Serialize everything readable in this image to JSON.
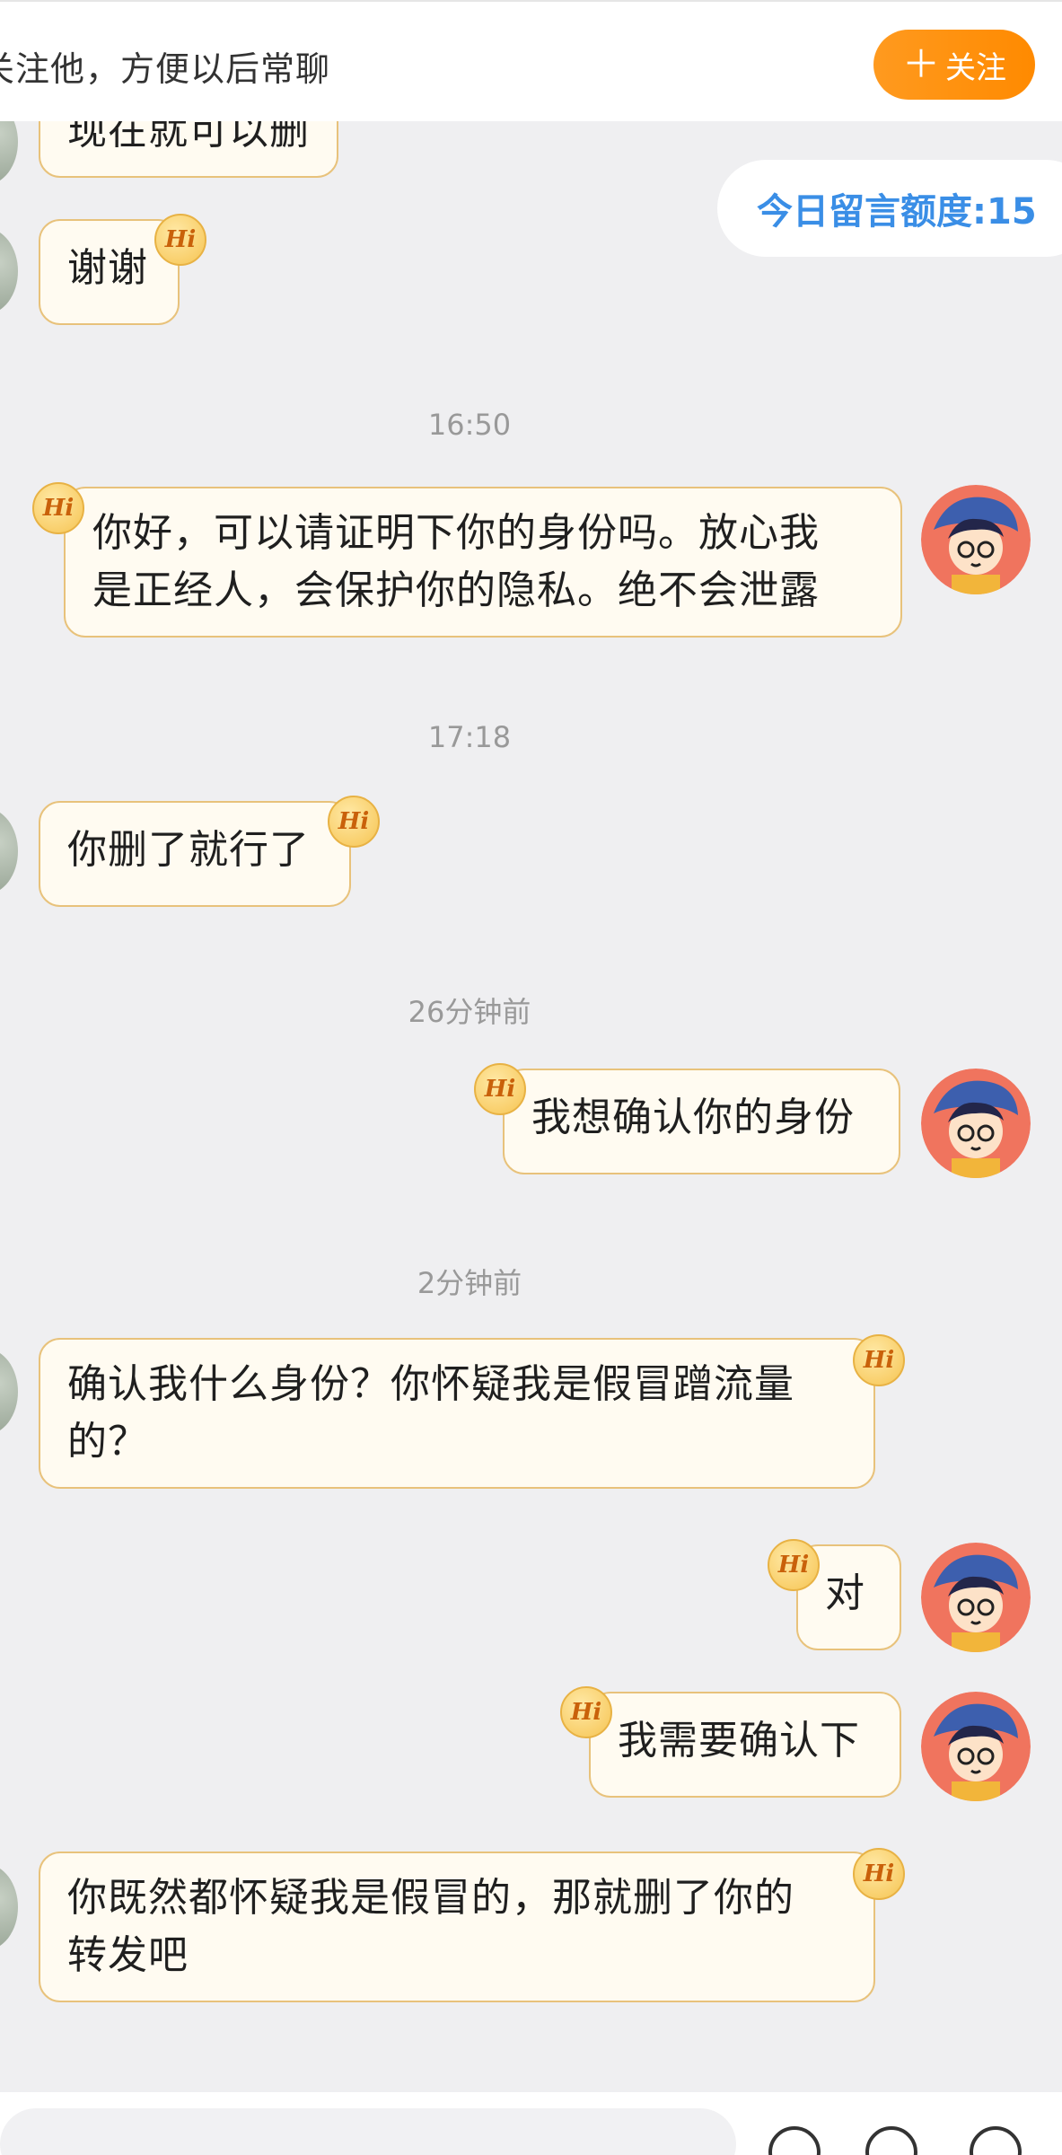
{
  "follow_bar": {
    "hint": "关注他，方便以后常聊",
    "follow_plus": "＋",
    "follow_label": "关注"
  },
  "quota": {
    "label": "今日留言额度:15"
  },
  "hi_badge": "Hi",
  "messages": [
    {
      "id": "m0",
      "side": "left",
      "text": "现在就可以删"
    },
    {
      "id": "m1",
      "side": "left",
      "text": "谢谢"
    },
    {
      "id": "t1",
      "type": "time",
      "text": "16:50"
    },
    {
      "id": "m2",
      "side": "right",
      "lines": [
        "你好，可以请证明下你的身份吗。放心我",
        "是正经人，会保护你的隐私。绝不会泄露"
      ]
    },
    {
      "id": "t2",
      "type": "time",
      "text": "17:18"
    },
    {
      "id": "m3",
      "side": "left",
      "text": "你删了就行了"
    },
    {
      "id": "t3",
      "type": "time",
      "text": "26分钟前"
    },
    {
      "id": "m4",
      "side": "right",
      "text": "我想确认你的身份"
    },
    {
      "id": "t4",
      "type": "time",
      "text": "2分钟前"
    },
    {
      "id": "m5",
      "side": "left",
      "lines": [
        "确认我什么身份？你怀疑我是假冒蹭流量",
        "的？"
      ]
    },
    {
      "id": "m6",
      "side": "right",
      "text": "对"
    },
    {
      "id": "m7",
      "side": "right",
      "text": "我需要确认下"
    },
    {
      "id": "m8",
      "side": "left",
      "lines": [
        "你既然都怀疑我是假冒的，那就删了你的",
        "转发吧"
      ]
    }
  ],
  "colors": {
    "accent_orange": "#ff8a00",
    "quota_blue": "#3a8ee6",
    "bubble_bg": "#fffbf1",
    "bubble_border": "#e8c27b",
    "chat_bg": "#efeff1"
  },
  "icons": [
    "hi-badge-icon",
    "avatar-cartoon-icon",
    "emoji-icon",
    "gift-icon",
    "add-icon"
  ]
}
